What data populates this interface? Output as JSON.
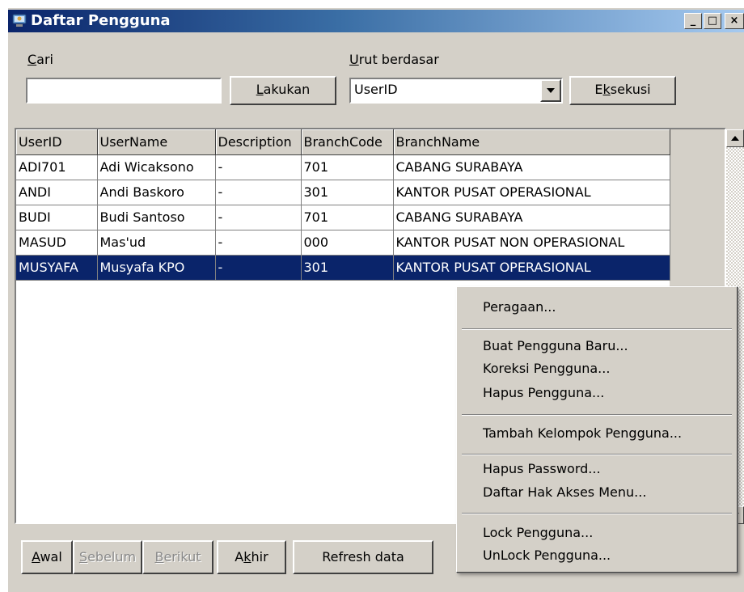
{
  "window": {
    "title": "Daftar Pengguna",
    "controls": {
      "minimize": "_",
      "maximize": "□",
      "close": "×"
    }
  },
  "search": {
    "label_accel": "C",
    "label_rest": "ari",
    "value": "",
    "button_accel": "L",
    "button_rest": "akukan"
  },
  "sort": {
    "label_accel": "U",
    "label_rest": "rut berdasar",
    "selected": "UserID",
    "button_pre": "E",
    "button_accel": "k",
    "button_rest": "sekusi"
  },
  "table": {
    "columns": [
      "UserID",
      "UserName",
      "Description",
      "BranchCode",
      "BranchName"
    ],
    "rows": [
      [
        "ADI701",
        "Adi Wicaksono",
        "-",
        "701",
        "CABANG SURABAYA"
      ],
      [
        "ANDI",
        "Andi Baskoro",
        "-",
        "301",
        "KANTOR PUSAT OPERASIONAL"
      ],
      [
        "BUDI",
        "Budi Santoso",
        "-",
        "701",
        "CABANG SURABAYA"
      ],
      [
        "MASUD",
        "Mas'ud",
        "-",
        "000",
        "KANTOR PUSAT NON OPERASIONAL"
      ],
      [
        "MUSYAFA",
        "Musyafa KPO",
        "-",
        "301",
        "KANTOR PUSAT OPERASIONAL"
      ]
    ],
    "selected_row": 4
  },
  "nav": {
    "first_accel": "A",
    "first_rest": "wal",
    "prev_accel": "S",
    "prev_rest": "ebelum",
    "next_accel": "B",
    "next_rest": "erikut",
    "last_pre": "A",
    "last_accel": "k",
    "last_rest": "hir",
    "refresh": "Refresh data"
  },
  "context_menu": {
    "items": [
      "Peragaan...",
      "Buat Pengguna Baru...",
      "Koreksi Pengguna...",
      "Hapus Pengguna...",
      "Tambah Kelompok Pengguna...",
      "Hapus Password...",
      "Daftar Hak Akses Menu...",
      "Lock Pengguna...",
      "UnLock Pengguna..."
    ]
  },
  "colors": {
    "title_start": "#0a246a",
    "title_end": "#a6caf0",
    "face": "#d4d0c8",
    "selection": "#0a246a"
  }
}
